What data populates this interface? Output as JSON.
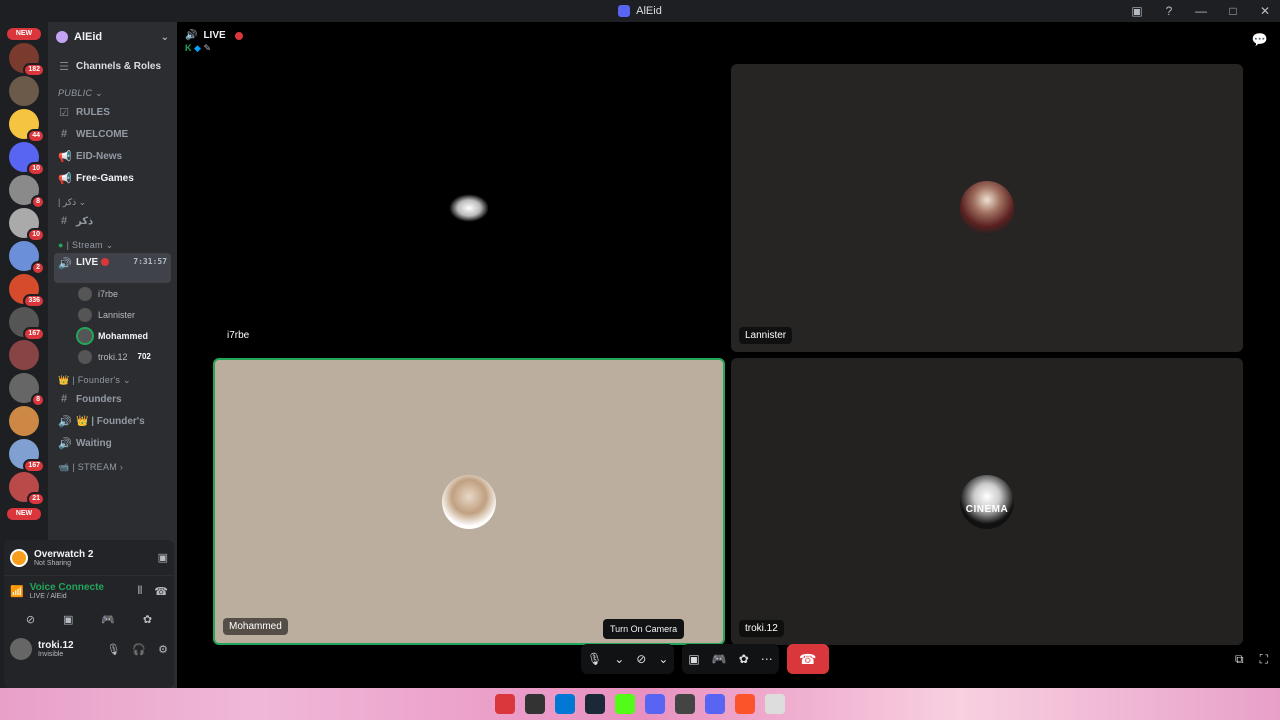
{
  "window": {
    "title": "AlEid"
  },
  "servers": [
    {
      "badge": "NEW",
      "type": "new"
    },
    {
      "badge": "182"
    },
    {
      "badge": ""
    },
    {
      "badge": "44"
    },
    {
      "badge": "10"
    },
    {
      "badge": "8"
    },
    {
      "badge": "10"
    },
    {
      "badge": "2"
    },
    {
      "badge": "336"
    },
    {
      "badge": "167"
    },
    {
      "badge": ""
    },
    {
      "badge": "8"
    },
    {
      "badge": ""
    },
    {
      "badge": "167"
    },
    {
      "badge": "21"
    },
    {
      "badge": "NEW",
      "type": "new"
    }
  ],
  "guild": {
    "name": "AlEid"
  },
  "sidebar": {
    "channels_roles": "Channels & Roles",
    "cat_public": "PUBLIC",
    "rules": "RULES",
    "welcome": "WELCOME",
    "eid_news": "EID-News",
    "free_games": "Free-Games",
    "cat_arabic": "| ذكر",
    "arabic_channel": "ذكر",
    "cat_stream": "| Stream",
    "live_channel": "LIVE",
    "live_time": "7:31:57",
    "voice_users": [
      {
        "name": "i7rbe"
      },
      {
        "name": "Lannister"
      },
      {
        "name": "Mohammed",
        "bold": true
      },
      {
        "name": "troki.12",
        "badge": "702"
      }
    ],
    "cat_founders": "| Founder's",
    "founders": "Founders",
    "founders_voice": "| Founder's",
    "waiting": "Waiting",
    "cat_stream2": "| STREAM"
  },
  "panel": {
    "activity_title": "Overwatch 2",
    "activity_sub": "Not Sharing",
    "voice_title": "Voice Connecte",
    "voice_sub": "LIVE / AlEid",
    "username": "troki.12",
    "status": "Invisible"
  },
  "stage": {
    "channel": "LIVE",
    "tiles": [
      {
        "name": "i7rbe"
      },
      {
        "name": "Lannister"
      },
      {
        "name": "Mohammed"
      },
      {
        "name": "troki.12"
      }
    ],
    "cinema_text": "CINEMA",
    "tooltip": "Turn On Camera"
  },
  "colors": {
    "accent_green": "#23a55a",
    "live_red": "#da373c"
  }
}
